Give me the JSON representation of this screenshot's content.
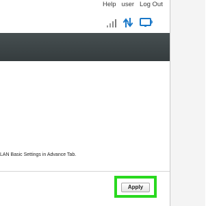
{
  "header": {
    "links": {
      "help": "Help",
      "user": "user",
      "logout": "Log Out"
    }
  },
  "status": {
    "icons": [
      "signal-strength-icon",
      "transfer-arrows-icon",
      "monitor-icon"
    ],
    "colors": {
      "signal": "#9a9a9a",
      "accent": "#1a78c8"
    }
  },
  "main": {
    "info_text": "LAN Basic Settings in Advance Tab."
  },
  "footer": {
    "apply_label": "Apply",
    "highlight_color": "#29d91f"
  },
  "colors": {
    "header_bar": "#3c4446",
    "background": "#ffffff"
  }
}
